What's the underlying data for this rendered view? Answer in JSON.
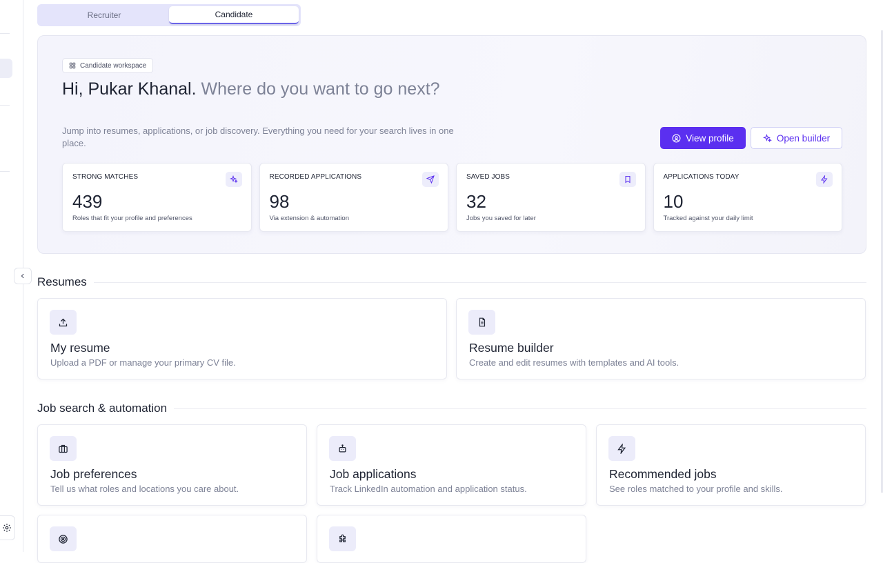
{
  "mode_switch": {
    "options": [
      "Recruiter",
      "Candidate"
    ],
    "selected": "Candidate"
  },
  "hero": {
    "badge": "Candidate workspace",
    "greeting": "Hi, Pukar Khanal.",
    "question": "Where do you want to go next?",
    "subtitle": "Jump into resumes, applications, or job discovery. Everything you need for your search lives in one place.",
    "view_profile": "View profile",
    "open_builder": "Open builder"
  },
  "stats": [
    {
      "label": "STRONG MATCHES",
      "value": "439",
      "desc": "Roles that fit your profile and preferences",
      "icon": "sparkles-icon"
    },
    {
      "label": "RECORDED APPLICATIONS",
      "value": "98",
      "desc": "Via extension & automation",
      "icon": "send-icon"
    },
    {
      "label": "SAVED JOBS",
      "value": "32",
      "desc": "Jobs you saved for later",
      "icon": "bookmark-icon"
    },
    {
      "label": "APPLICATIONS TODAY",
      "value": "10",
      "desc": "Tracked against your daily limit",
      "icon": "lightning-icon"
    }
  ],
  "resumes": {
    "heading": "Resumes",
    "cards": [
      {
        "title": "My resume",
        "desc": "Upload a PDF or manage your primary CV file.",
        "icon": "upload-icon"
      },
      {
        "title": "Resume builder",
        "desc": "Create and edit resumes with templates and AI tools.",
        "icon": "document-icon"
      }
    ]
  },
  "automation": {
    "heading": "Job search & automation",
    "cards": [
      {
        "title": "Job preferences",
        "desc": "Tell us what roles and locations you care about.",
        "icon": "briefcase-icon"
      },
      {
        "title": "Job applications",
        "desc": "Track LinkedIn automation and application status.",
        "icon": "robot-icon"
      },
      {
        "title": "Recommended jobs",
        "desc": "See roles matched to your profile and skills.",
        "icon": "lightning-icon"
      },
      {
        "title": "",
        "desc": "",
        "icon": "target-icon"
      },
      {
        "title": "",
        "desc": "",
        "icon": "puzzle-icon"
      }
    ]
  },
  "colors": {
    "accent": "#5b2ff0",
    "icon_bg": "#ececfa",
    "segment_bg": "#e4e4fb"
  }
}
